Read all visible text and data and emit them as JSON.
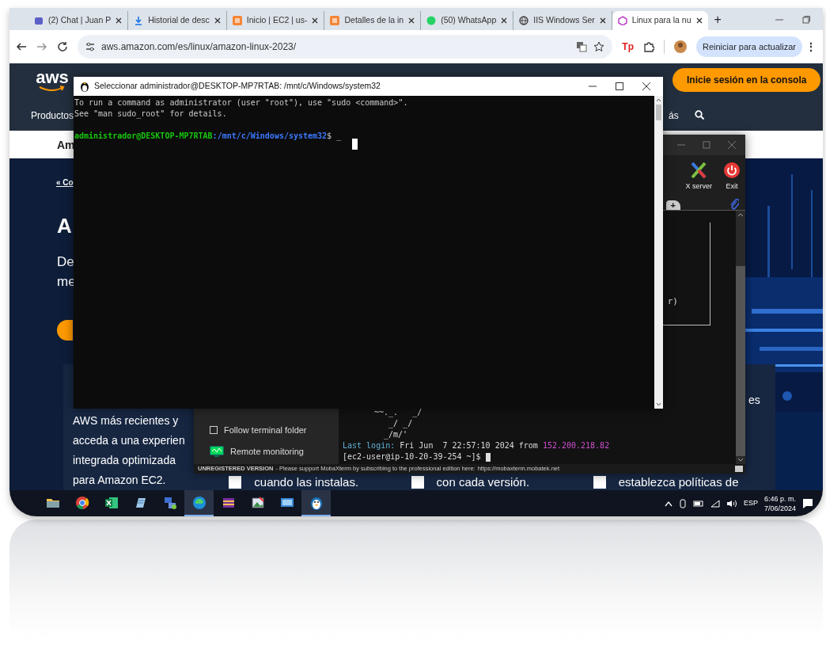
{
  "browser": {
    "tabs": [
      {
        "title": "(2) Chat | Juan P",
        "kind": "teams",
        "selected": false
      },
      {
        "title": "Historial de desc",
        "kind": "download",
        "selected": false
      },
      {
        "title": "Inicio | EC2 | us-",
        "kind": "aws",
        "selected": false
      },
      {
        "title": "Detalles de la in",
        "kind": "aws",
        "selected": false
      },
      {
        "title": "(50) WhatsApp",
        "kind": "whatsapp",
        "selected": false
      },
      {
        "title": "IIS Windows Ser",
        "kind": "globe",
        "selected": false
      },
      {
        "title": "Linux para la nu",
        "kind": "cube",
        "selected": true
      }
    ],
    "new_tab": "+",
    "url": "aws.amazon.com/es/linux/amazon-linux-2023/",
    "extension_badge": "Tp",
    "update_button": "Reiniciar para actualizar",
    "menu": "⋮"
  },
  "aws_page": {
    "logo": "aws",
    "signin_button": "Inicie sesión en la consola",
    "nav_label": "Productos",
    "nav_fragment": "ás",
    "subnav_fragment": "Am",
    "breadcrumb_fragment": "« Co",
    "heading_fragment": "A",
    "intro_lines": [
      "De",
      "me"
    ],
    "card_lines": [
      "AWS más recientes y",
      "acceda a una experien",
      "integrada optimizada",
      "para Amazon EC2."
    ],
    "list_items": [
      "cuando las instalas.",
      "con cada versión.",
      "establezca políticas de"
    ],
    "side_fragment": "es"
  },
  "terminal": {
    "title": "Seleccionar administrador@DESKTOP-MP7RTAB: /mnt/c/Windows/system32",
    "lines": [
      "To run a command as administrator (user \"root\"), use \"sudo <command>\".",
      "See \"man sudo_root\" for details."
    ],
    "prompt": {
      "user": "administrador@DESKTOP-MP7RTAB",
      "path": ":/mnt/c/Windows/system32",
      "symbol": "$",
      "input": "_"
    }
  },
  "mobaxterm": {
    "toolbar": [
      {
        "label": "X server",
        "kind": "xserver"
      },
      {
        "label": "Exit",
        "kind": "exit"
      }
    ],
    "new_tab": "+",
    "terminal_fragment": "r)",
    "ascii_art": [
      "~~._.   _/",
      "   _/ _/",
      "  _/m/'"
    ],
    "last_login": {
      "label": "Last login:",
      "text": " Fri Jun  7 22:57:10 2024 from ",
      "ip": "152.200.218.82"
    },
    "prompt": "[ec2-user@ip-10-20-39-254 ~]$ ",
    "sidebar": [
      {
        "label": "Follow terminal folder",
        "kind": "checkbox",
        "checked": false
      },
      {
        "label": "Remote monitoring",
        "kind": "button"
      }
    ],
    "status": {
      "label": "UNREGISTERED VERSION",
      "text": " - Please support MobaXterm by subscribing to the professional edition here:",
      "link": "https://mobaxterm.mobatek.net"
    }
  },
  "taskbar": {
    "apps": [
      {
        "kind": "folder",
        "active": false
      },
      {
        "kind": "chrome",
        "active": false
      },
      {
        "kind": "excel",
        "active": false
      },
      {
        "kind": "notepad",
        "active": false
      },
      {
        "kind": "network",
        "active": false
      },
      {
        "kind": "edge",
        "active": true
      },
      {
        "kind": "archive",
        "active": false
      },
      {
        "kind": "paint",
        "active": false
      },
      {
        "kind": "remote",
        "active": false
      },
      {
        "kind": "mobaxterm",
        "active": true
      }
    ],
    "language": "ESP",
    "time": "6:46 p. m.",
    "date": "7/06/2024"
  }
}
